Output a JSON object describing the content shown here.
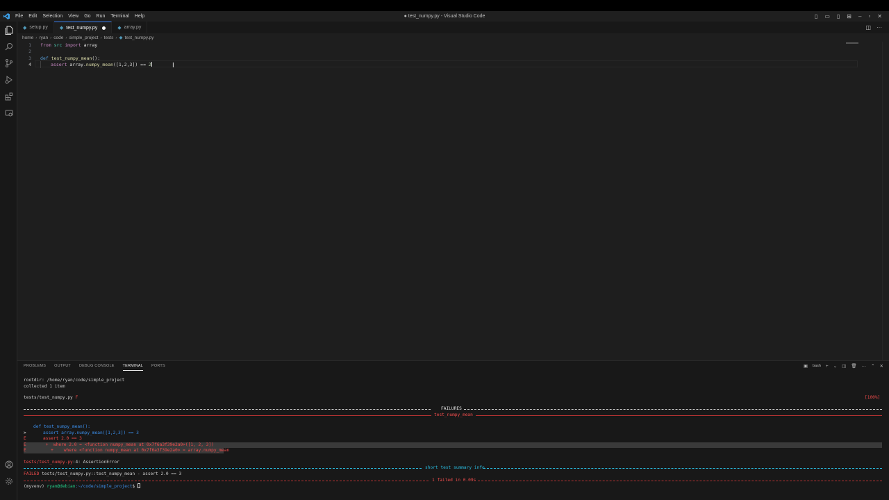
{
  "titlebar": {
    "menu": [
      "File",
      "Edit",
      "Selection",
      "View",
      "Go",
      "Run",
      "Terminal",
      "Help"
    ],
    "title": "● test_numpy.py - Visual Studio Code"
  },
  "tabs": [
    {
      "label": "setup.py",
      "active": false,
      "modified": false
    },
    {
      "label": "test_numpy.py",
      "active": true,
      "modified": true
    },
    {
      "label": "array.py",
      "active": false,
      "modified": false
    }
  ],
  "breadcrumb": [
    "home",
    "ryan",
    "code",
    "simple_project",
    "tests",
    "test_numpy.py"
  ],
  "editor": {
    "line_numbers": [
      "1",
      "2",
      "3",
      "4"
    ],
    "current_line": "4",
    "lines": {
      "l1": {
        "kw": "from",
        "mod": "src",
        "kw2": "import",
        "name": "array"
      },
      "l3": {
        "kw": "def",
        "fn": "test_numpy_mean",
        "rest": "():"
      },
      "l4": {
        "kw": "assert",
        "obj": "array",
        "dot": ".",
        "fn": "numpy_mean",
        "args": "([1,2,3]) == ",
        "num": "2"
      }
    }
  },
  "panel": {
    "tabs": [
      "PROBLEMS",
      "OUTPUT",
      "DEBUG CONSOLE",
      "TERMINAL",
      "PORTS"
    ],
    "active_tab": "TERMINAL",
    "shell": "bash"
  },
  "terminal": {
    "rootdir": "rootdir: /home/ryan/code/simple_project",
    "collected": "collected 1 item",
    "test_file": "tests/test_numpy.py",
    "test_result": "F",
    "progress": "[100%]",
    "failures_header": "FAILURES",
    "failure_name": "test_numpy_mean",
    "def_line": "def test_numpy_mean():",
    "assert_marker": ">",
    "assert_line": "assert array.numpy_mean([1,2,3]) == 3",
    "e1_marker": "E",
    "e1_text": "assert 2.0 == 3",
    "e2_marker": "E",
    "e2_text": " +  where 2.0 = <function numpy_mean at 0x7f6a3f39e2a0>([1, 2, 3])",
    "e3_marker": "E",
    "e3_text": "   +    where <function numpy_mean at 0x7f6a3f39e2a0> = array.numpy_mean",
    "error_location": "tests/test_numpy.py",
    "error_lineno": ":4",
    "error_type": ": AssertionError",
    "summary_header": "short test summary info",
    "failed_label": "FAILED",
    "failed_detail": " tests/test_numpy.py::test_numpy_mean - assert 2.0 == 3",
    "result_line": "1 failed in 0.09s",
    "prompt_env": "(myvenv) ",
    "prompt_user": "ryan@debian",
    "prompt_path": ":~/code/simple_project",
    "prompt_sigil": "$ "
  }
}
